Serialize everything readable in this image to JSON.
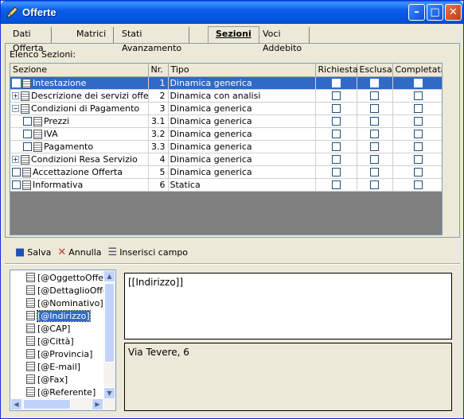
{
  "window": {
    "title": "Offerte"
  },
  "tabs": [
    {
      "label": "Dati Offerta"
    },
    {
      "label": "Matrici"
    },
    {
      "label": "Stati Avanzamento"
    },
    {
      "label": "Sezioni"
    },
    {
      "label": "Voci Addebito"
    }
  ],
  "sections": {
    "label": "Elenco Sezioni:",
    "columns": [
      "Sezione",
      "Nr.",
      "Tipo",
      "Richiesta",
      "Esclusa",
      "Completata"
    ],
    "rows": [
      {
        "name": "Intestazione",
        "nr": "1",
        "tipo": "Dinamica generica"
      },
      {
        "name": "Descrizione dei servizi offerti",
        "nr": "2",
        "tipo": "Dinamica con analisi"
      },
      {
        "name": "Condizioni di Pagamento",
        "nr": "3",
        "tipo": "Dinamica generica"
      },
      {
        "name": "Prezzi",
        "nr": "3.1",
        "tipo": "Dinamica generica"
      },
      {
        "name": "IVA",
        "nr": "3.2",
        "tipo": "Dinamica generica"
      },
      {
        "name": "Pagamento",
        "nr": "3.3",
        "tipo": "Dinamica generica"
      },
      {
        "name": "Condizioni Resa Servizio",
        "nr": "4",
        "tipo": "Dinamica generica"
      },
      {
        "name": "Accettazione Offerta",
        "nr": "5",
        "tipo": "Dinamica generica"
      },
      {
        "name": "Informativa",
        "nr": "6",
        "tipo": "Statica"
      }
    ]
  },
  "toolbar": {
    "save": "Salva",
    "cancel": "Annulla",
    "insert": "Inserisci campo"
  },
  "fields": [
    "[@OggettoOfferta]",
    "[@DettaglioOfferta]",
    "[@Nominativo]",
    "[@Indirizzo]",
    "[@CAP]",
    "[@Città]",
    "[@Provincia]",
    "[@E-mail]",
    "[@Fax]",
    "[@Referente]"
  ],
  "editor": {
    "template": "[[Indirizzo]]",
    "preview": "Via Tevere, 6"
  }
}
